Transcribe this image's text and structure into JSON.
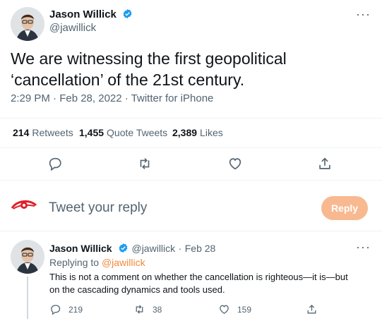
{
  "tweet": {
    "author_name": "Jason Willick",
    "author_handle": "@jawillick",
    "text": "We are witnessing the first geopolitical ‘cancellation’ of the 21st century.",
    "timestamp": "2:29 PM · Feb 28, 2022 · Twitter for iPhone",
    "more_label": "···"
  },
  "stats": {
    "retweets_count": "214",
    "retweets_label": "Retweets",
    "quote_tweets_count": "1,455",
    "quote_tweets_label": "Quote Tweets",
    "likes_count": "2,389",
    "likes_label": "Likes"
  },
  "composer": {
    "placeholder": "Tweet your reply",
    "reply_button": "Reply"
  },
  "reply_tweet": {
    "author_name": "Jason Willick",
    "author_handle": "@jawillick",
    "separator": "·",
    "date": "Feb 28",
    "replying_prefix": "Replying to",
    "replying_to": "@jawillick",
    "text": "This is not a comment on whether the cancellation is righteous—it is—but on the cascading dynamics and tools used.",
    "replies": "219",
    "retweets": "38",
    "likes": "159",
    "more_label": "···"
  },
  "colors": {
    "verified": "#1d9bf0",
    "reply_button_bg": "#f8b990",
    "mention": "#f28a3b",
    "logo": "#e0202a"
  },
  "icons": [
    "verified-badge-icon",
    "more-icon",
    "reply-icon",
    "retweet-icon",
    "like-icon",
    "share-icon",
    "eye-logo-icon"
  ]
}
